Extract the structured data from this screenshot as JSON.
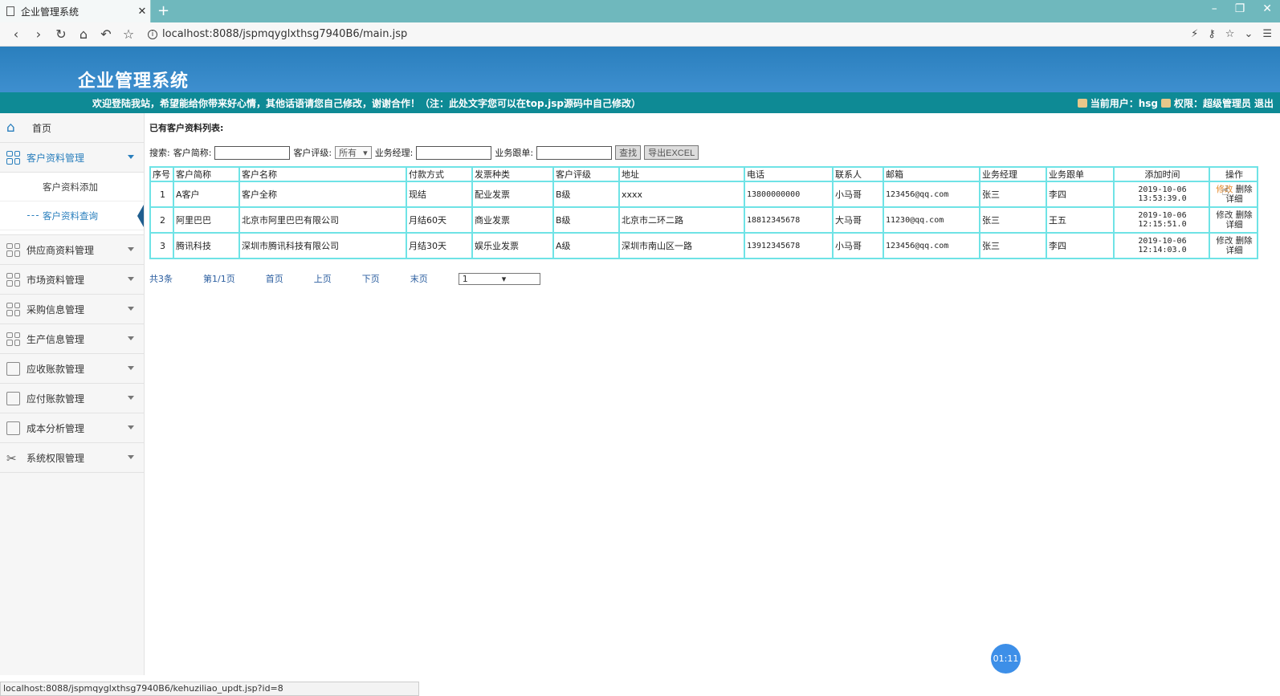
{
  "browser": {
    "tab_title": "企业管理系统",
    "url": "localhost:8088/jspmqyglxthsg7940B6/main.jsp",
    "status_url": "localhost:8088/jspmqyglxthsg7940B6/kehuziliao_updt.jsp?id=8"
  },
  "header": {
    "title": "企业管理系统",
    "welcome": "欢迎登陆我站，希望能给你带来好心情，其他话语请您自己修改，谢谢合作！（注：此处文字您可以在top.jsp源码中自己修改）",
    "current_user_label": "当前用户：hsg",
    "permission_label": "权限：超级管理员",
    "logout": "退出"
  },
  "sidebar": {
    "home": "首页",
    "items": [
      {
        "label": "客户资料管理",
        "icon": "grid-icon"
      },
      {
        "label": "供应商资料管理",
        "icon": "grid-icon"
      },
      {
        "label": "市场资料管理",
        "icon": "grid-icon"
      },
      {
        "label": "采购信息管理",
        "icon": "grid-icon"
      },
      {
        "label": "生产信息管理",
        "icon": "grid-icon"
      },
      {
        "label": "应收账款管理",
        "icon": "ledger-icon"
      },
      {
        "label": "应付账款管理",
        "icon": "ledger-icon"
      },
      {
        "label": "成本分析管理",
        "icon": "ledger-icon"
      },
      {
        "label": "系统权限管理",
        "icon": "tools-icon"
      }
    ],
    "sub_items": [
      "客户资料添加",
      "客户资料查询"
    ]
  },
  "main": {
    "list_title": "已有客户资料列表:",
    "search": {
      "label": "搜索:",
      "short_name_label": "客户简称:",
      "rating_label": "客户评级:",
      "rating_value": "所有",
      "manager_label": "业务经理:",
      "follower_label": "业务跟单:",
      "search_btn": "查找",
      "export_btn": "导出EXCEL"
    },
    "columns": [
      "序号",
      "客户简称",
      "客户名称",
      "付款方式",
      "发票种类",
      "客户评级",
      "地址",
      "电话",
      "联系人",
      "邮箱",
      "业务经理",
      "业务跟单",
      "添加时间",
      "操作"
    ],
    "rows": [
      {
        "no": "1",
        "short": "A客户",
        "name": "客户全称",
        "pay": "现结",
        "invoice": "配业发票",
        "rating": "B级",
        "addr": "xxxx",
        "phone": "13800000000",
        "contact": "小马哥",
        "email": "123456@qq.com",
        "manager": "张三",
        "follower": "李四",
        "time": "2019-10-06 13:53:39.0"
      },
      {
        "no": "2",
        "short": "阿里巴巴",
        "name": "北京市阿里巴巴有限公司",
        "pay": "月结60天",
        "invoice": "商业发票",
        "rating": "B级",
        "addr": "北京市二环二路",
        "phone": "18812345678",
        "contact": "大马哥",
        "email": "11230@qq.com",
        "manager": "张三",
        "follower": "王五",
        "time": "2019-10-06 12:15:51.0"
      },
      {
        "no": "3",
        "short": "腾讯科技",
        "name": "深圳市腾讯科技有限公司",
        "pay": "月结30天",
        "invoice": "娱乐业发票",
        "rating": "A级",
        "addr": "深圳市南山区一路",
        "phone": "13912345678",
        "contact": "小马哥",
        "email": "123456@qq.com",
        "manager": "张三",
        "follower": "李四",
        "time": "2019-10-06 12:14:03.0"
      }
    ],
    "ops": {
      "edit": "修改",
      "delete": "删除",
      "detail": "详细"
    },
    "pager": {
      "total": "共3条",
      "page": "第1/1页",
      "first": "首页",
      "prev": "上页",
      "next": "下页",
      "last": "末页",
      "select_value": "1"
    }
  },
  "timer": "01:11"
}
